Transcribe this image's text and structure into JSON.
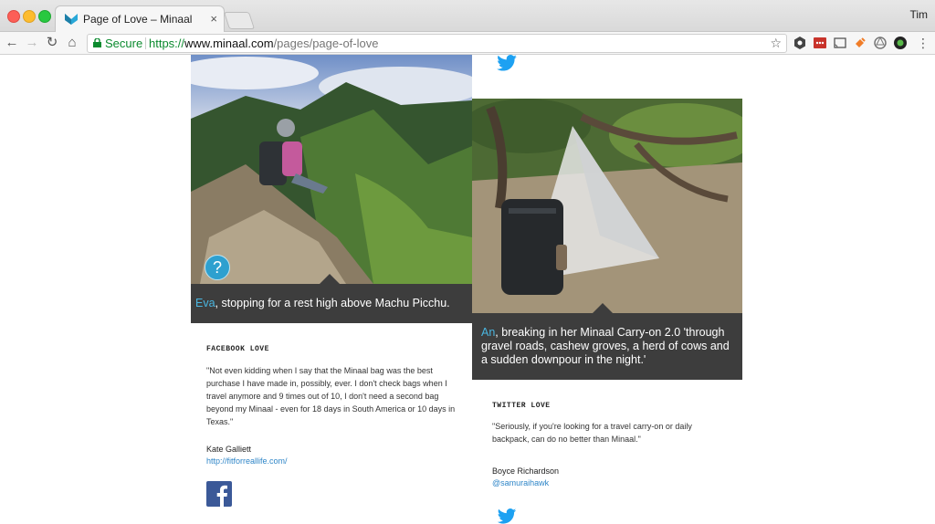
{
  "browser": {
    "tab_title": "Page of Love – Minaal",
    "tab_close": "×",
    "user_name": "Tim",
    "secure_label": "Secure",
    "url_scheme": "https://",
    "url_host": "www.minaal.com",
    "url_path": "/pages/page-of-love",
    "icons": [
      "back-icon",
      "forward-icon",
      "reload-icon",
      "home-icon",
      "lock-icon",
      "star-icon",
      "extension-icons"
    ]
  },
  "posts": {
    "eva": {
      "name": "Eva",
      "text": ", stopping for a rest high above Machu Picchu."
    },
    "an": {
      "name": "An",
      "text": ", breaking in her Minaal Carry-on 2.0 'through gravel roads, cashew groves, a herd of cows and a sudden downpour in the night.'"
    }
  },
  "facebook_love": {
    "label": "FACEBOOK LOVE",
    "quote": "\"Not even kidding when I say that the Minaal bag was the best purchase I have made in, possibly, ever. I don't check bags when I travel anymore and 9 times out of 10, I don't need a second bag beyond my Minaal - even for 18 days in South America or 10 days in Texas.\"",
    "author": "Kate Galliett",
    "link": "http://fitforreallife.com/"
  },
  "twitter_love": {
    "label": "TWITTER LOVE",
    "quote": "\"Seriously, if you're looking for a travel carry-on or daily backpack, can do no better than Minaal.\"",
    "author": "Boyce Richardson",
    "handle": "@samuraihawk"
  },
  "help_button": "?",
  "colors": {
    "accent": "#4ab6e0",
    "caption_bg": "#3d3d3d",
    "facebook": "#3b5998",
    "twitter": "#1da1f2",
    "link": "#2f86c8"
  }
}
